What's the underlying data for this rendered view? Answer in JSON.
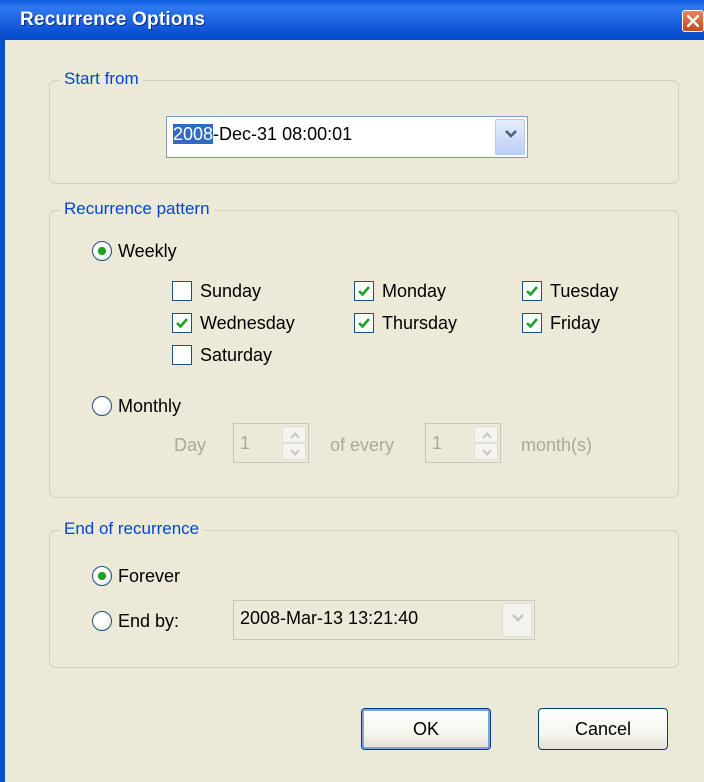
{
  "window": {
    "title": "Recurrence Options"
  },
  "start_from": {
    "legend": "Start from",
    "date_year_selected": "2008",
    "date_rest": "-Dec-31 08:00:01"
  },
  "pattern": {
    "legend": "Recurrence pattern",
    "weekly_label": "Weekly",
    "weekly_selected": true,
    "days": [
      {
        "label": "Sunday",
        "checked": false
      },
      {
        "label": "Monday",
        "checked": true
      },
      {
        "label": "Tuesday",
        "checked": true
      },
      {
        "label": "Wednesday",
        "checked": true
      },
      {
        "label": "Thursday",
        "checked": true
      },
      {
        "label": "Friday",
        "checked": true
      },
      {
        "label": "Saturday",
        "checked": false
      }
    ],
    "monthly_label": "Monthly",
    "monthly_selected": false,
    "day_label": "Day",
    "day_value": "1",
    "of_every_label": "of every",
    "every_value": "1",
    "months_label": "month(s)"
  },
  "end": {
    "legend": "End of recurrence",
    "forever_label": "Forever",
    "forever_selected": true,
    "end_by_label": "End by:",
    "end_by_selected": false,
    "end_by_value": "2008-Mar-13 13:21:40"
  },
  "buttons": {
    "ok": "OK",
    "cancel": "Cancel"
  },
  "colors": {
    "title_bar": "#0A4FD0",
    "legend_text": "#0046D5",
    "dialog_bg": "#ECE9D8",
    "selection": "#316AC5",
    "check_mark": "#21A121"
  }
}
